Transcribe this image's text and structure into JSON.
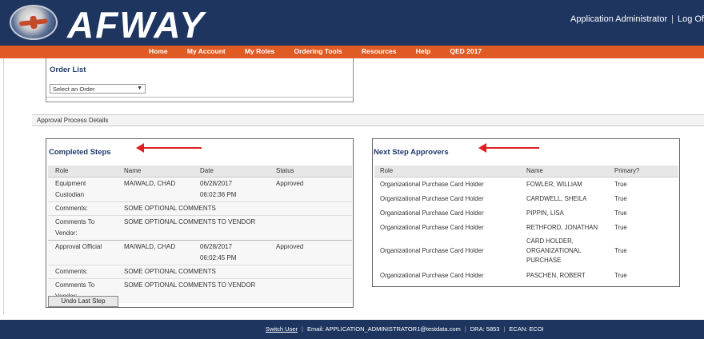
{
  "header": {
    "brand": "AFWAY",
    "user_role": "Application Administrator",
    "separator": "|",
    "logout": "Log Of"
  },
  "nav": {
    "items": [
      "Home",
      "My Account",
      "My Roles",
      "Ordering Tools",
      "Resources",
      "Help",
      "QED 2017"
    ]
  },
  "order_list": {
    "title": "Order List",
    "select_value": "Select an Order"
  },
  "approval_bar": {
    "label": "Approval Process Details"
  },
  "completed_steps": {
    "title": "Completed Steps",
    "headers": [
      "Role",
      "Name",
      "Date",
      "Status"
    ],
    "steps": [
      {
        "role_line1": "Equipment",
        "role_line2": "Custodian",
        "name": "MAIWALD, CHAD",
        "date": "06/28/2017",
        "time": "06:02:36 PM",
        "status": "Approved",
        "comments_label": "Comments:",
        "comments": "SOME OPTIONAL COMMENTS",
        "vendor_label_1": "Comments To",
        "vendor_label_2": "Vendor:",
        "vendor_comments": "SOME OPTIONAL COMMENTS TO VENDOR"
      },
      {
        "role_line1": "Approval Official",
        "role_line2": "",
        "name": "MAIWALD, CHAD",
        "date": "06/28/2017",
        "time": "06:02:45 PM",
        "status": "Approved",
        "comments_label": "Comments:",
        "comments": "SOME OPTIONAL COMMENTS",
        "vendor_label_1": "Comments To",
        "vendor_label_2": "Vendor:",
        "vendor_comments": "SOME OPTIONAL COMMENTS TO VENDOR"
      }
    ],
    "undo_button": "Undo Last Step"
  },
  "next_approvers": {
    "title": "Next Step Approvers",
    "headers": [
      "Role",
      "Name",
      "Primary?"
    ],
    "rows": [
      {
        "role": "Organizational Purchase Card Holder",
        "name": "FOWLER, WILLIAM",
        "primary": "True"
      },
      {
        "role": "Organizational Purchase Card Holder",
        "name": "CARDWELL, SHEILA",
        "primary": "True"
      },
      {
        "role": "Organizational Purchase Card Holder",
        "name": "PIPPIN, LISA",
        "primary": "True"
      },
      {
        "role": "Organizational Purchase Card Holder",
        "name": "RETHFORD, JONATHAN",
        "primary": "True"
      },
      {
        "role": "Organizational Purchase Card Holder",
        "name_line1": "CARD HOLDER,",
        "name_line2": "ORGANIZATIONAL",
        "name_line3": "PURCHASE",
        "primary": "True"
      },
      {
        "role": "Organizational Purchase Card Holder",
        "name": "PASCHEN, ROBERT",
        "primary": "True"
      }
    ]
  },
  "footer": {
    "switch_user": "Switch User",
    "sep": "|",
    "email": "Email: APPLICATION_ADMINISTRATOR1@testdata.com",
    "dra": "DRA: 5853",
    "ecan": "ECAN: ECOI"
  },
  "colors": {
    "header_bg": "#1e3560",
    "nav_bg": "#e05a24",
    "title_blue": "#1f3a6e",
    "annotation_red": "#e02020"
  }
}
